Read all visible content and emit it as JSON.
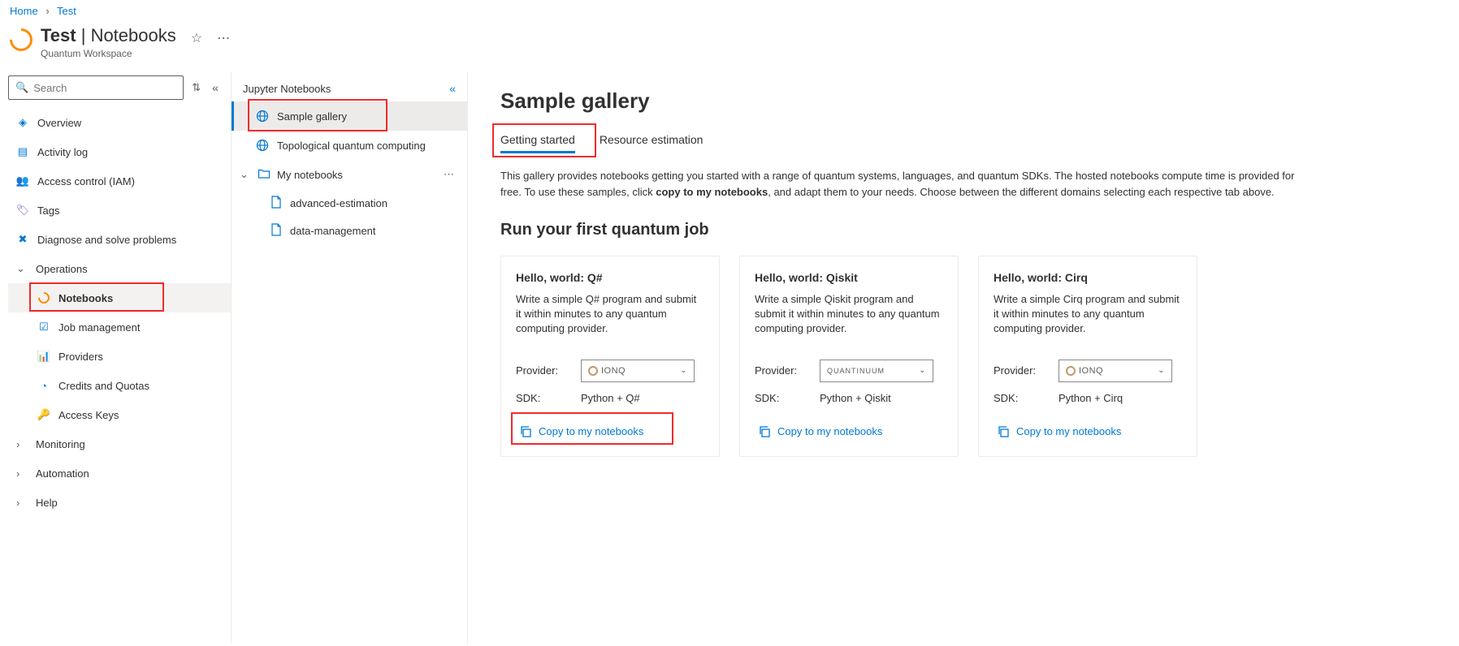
{
  "breadcrumb": {
    "home": "Home",
    "current": "Test"
  },
  "heading": {
    "title_bold": "Test",
    "title_rest": "Notebooks",
    "subtitle": "Quantum Workspace"
  },
  "search": {
    "placeholder": "Search"
  },
  "side1": {
    "overview": "Overview",
    "activity": "Activity log",
    "access": "Access control (IAM)",
    "tags": "Tags",
    "diag": "Diagnose and solve problems",
    "ops_group": "Operations",
    "notebooks": "Notebooks",
    "jobmgmt": "Job management",
    "providers": "Providers",
    "credits": "Credits and Quotas",
    "keys": "Access Keys",
    "monitoring": "Monitoring",
    "automation": "Automation",
    "help": "Help"
  },
  "side2": {
    "title": "Jupyter Notebooks",
    "sample_gallery": "Sample gallery",
    "topo": "Topological quantum computing",
    "my_notebooks": "My notebooks",
    "file1": "advanced-estimation",
    "file2": "data-management"
  },
  "main": {
    "title": "Sample gallery",
    "tab1": "Getting started",
    "tab2": "Resource estimation",
    "desc_a": "This gallery provides notebooks getting you started with a range of quantum systems, languages, and quantum SDKs. The hosted notebooks compute time is provided for free. To use these samples, click ",
    "desc_bold": "copy to my notebooks",
    "desc_b": ", and adapt them to your needs. Choose between the different domains selecting each respective tab above.",
    "section": "Run your first quantum job",
    "provider_label": "Provider:",
    "sdk_label": "SDK:",
    "copy_label": "Copy to my notebooks",
    "cards": [
      {
        "title": "Hello, world: Q#",
        "desc": "Write a simple Q# program and submit it within minutes to any quantum computing provider.",
        "provider": "IONQ",
        "sdk": "Python + Q#"
      },
      {
        "title": "Hello, world: Qiskit",
        "desc": "Write a simple Qiskit program and submit it within minutes to any quantum computing provider.",
        "provider": "QUANTINUUM",
        "sdk": "Python + Qiskit"
      },
      {
        "title": "Hello, world: Cirq",
        "desc": "Write a simple Cirq program and submit it within minutes to any quantum computing provider.",
        "provider": "IONQ",
        "sdk": "Python + Cirq"
      }
    ]
  }
}
